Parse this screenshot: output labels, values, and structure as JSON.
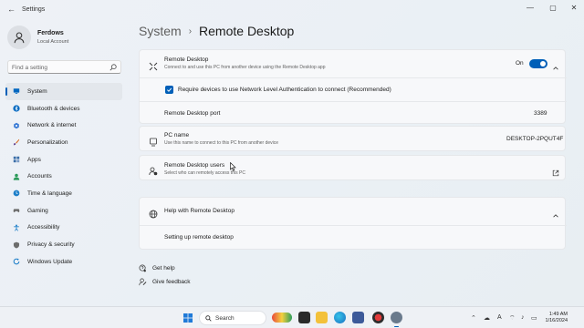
{
  "window": {
    "title": "Settings"
  },
  "profile": {
    "name": "Ferdows",
    "account": "Local Account"
  },
  "search": {
    "placeholder": "Find a setting"
  },
  "sidebar": {
    "items": [
      {
        "label": "System",
        "icon": "monitor-icon",
        "color": "#0067c0",
        "active": true
      },
      {
        "label": "Bluetooth & devices",
        "icon": "bluetooth-icon",
        "color": "#0067c0"
      },
      {
        "label": "Network & internet",
        "icon": "network-icon",
        "color": "#3a7bd5"
      },
      {
        "label": "Personalization",
        "icon": "brush-icon",
        "color": "#d96a1e"
      },
      {
        "label": "Apps",
        "icon": "apps-icon",
        "color": "#3b6ea8"
      },
      {
        "label": "Accounts",
        "icon": "accounts-icon",
        "color": "#2b9a5a"
      },
      {
        "label": "Time & language",
        "icon": "globe-clock-icon",
        "color": "#1e7fc9"
      },
      {
        "label": "Gaming",
        "icon": "gamepad-icon",
        "color": "#6c6c6c"
      },
      {
        "label": "Accessibility",
        "icon": "accessibility-icon",
        "color": "#1e7fc9"
      },
      {
        "label": "Privacy & security",
        "icon": "shield-icon",
        "color": "#6c6c6c"
      },
      {
        "label": "Windows Update",
        "icon": "update-icon",
        "color": "#1e7fc9"
      }
    ]
  },
  "breadcrumb": {
    "parent": "System",
    "separator": "›",
    "current": "Remote Desktop"
  },
  "remote_desktop": {
    "title": "Remote Desktop",
    "subtitle": "Connect to and use this PC from another device using the Remote Desktop app",
    "toggle_label": "On",
    "toggle_on": true,
    "nla_label": "Require devices to use Network Level Authentication to connect (Recommended)",
    "nla_checked": true,
    "port_label": "Remote Desktop port",
    "port_value": "3389"
  },
  "pc_name": {
    "title": "PC name",
    "subtitle": "Use this name to connect to this PC from another device",
    "value": "DESKTOP-2PQUT4F"
  },
  "users": {
    "title": "Remote Desktop users",
    "subtitle": "Select who can remotely access this PC"
  },
  "help": {
    "title": "Help with Remote Desktop",
    "link": "Setting up remote desktop"
  },
  "footer": {
    "get_help": "Get help",
    "give_feedback": "Give feedback"
  },
  "taskbar": {
    "search_label": "Search",
    "time": "1:49 AM",
    "date": "1/16/2024"
  },
  "colors": {
    "accent": "#005fb8"
  }
}
